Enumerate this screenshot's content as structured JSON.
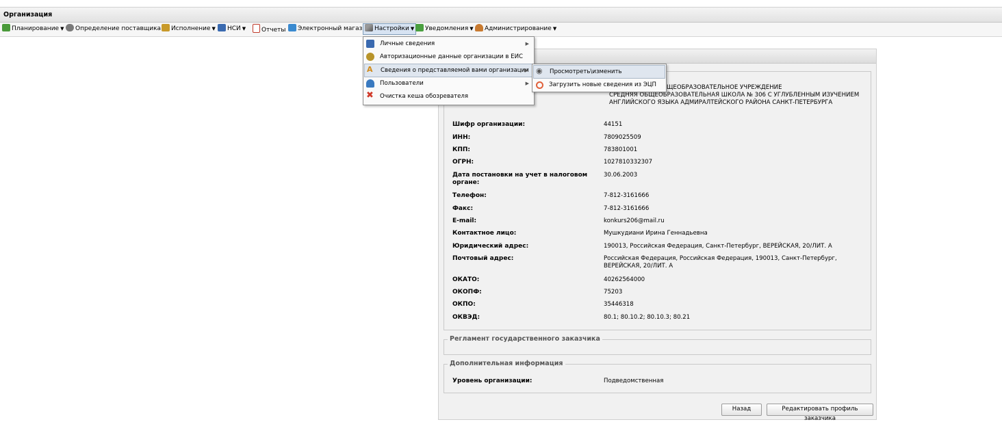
{
  "window": {
    "title": "Организация"
  },
  "toolbar": {
    "items": [
      {
        "label": "Планирование",
        "icon": "planning-icon",
        "color": "#4a9a3a",
        "has_arrow": true
      },
      {
        "label": "Определение поставщика",
        "icon": "supplier-gears-icon",
        "color": "#6b6b6b",
        "has_arrow": true
      },
      {
        "label": "Исполнение",
        "icon": "execution-icon",
        "color": "#c89a2a",
        "has_arrow": true
      },
      {
        "label": "НСИ",
        "icon": "nsi-book-icon",
        "color": "#3a6ab0",
        "has_arrow": true
      },
      {
        "label": "Отчеты",
        "icon": "report-icon",
        "color": "#c03a2a",
        "has_arrow": false
      },
      {
        "label": "Электронный магазин",
        "icon": "cart-icon",
        "color": "#3a8ad0",
        "has_arrow": false
      },
      {
        "label": "Настройки",
        "icon": "wrench-icon",
        "color": "#777777",
        "has_arrow": true
      },
      {
        "label": "Уведомления",
        "icon": "notification-icon",
        "color": "#4aa040",
        "has_arrow": true
      },
      {
        "label": "Администрирование",
        "icon": "admin-user-icon",
        "color": "#c87a30",
        "has_arrow": true
      }
    ]
  },
  "settings_menu": {
    "items": [
      {
        "label": "Личные сведения",
        "icon": "id-card-icon",
        "color": "#3a6ab0",
        "submenu": true
      },
      {
        "label": "Авторизационные данные организации в ЕИС",
        "icon": "emblem-icon",
        "color": "#b8942a",
        "submenu": false
      },
      {
        "label": "Сведения о представляемой вами организации",
        "icon": "letter-a-icon",
        "color": "#d08a1a",
        "submenu": true
      },
      {
        "label": "Пользователи",
        "icon": "users-icon",
        "color": "#3a7ac0",
        "submenu": true
      },
      {
        "label": "Очистка кеша обозревателя",
        "icon": "red-x-icon",
        "color": "#d03a2a",
        "submenu": false
      }
    ]
  },
  "org_submenu": {
    "items": [
      {
        "label": "Просмотреть\\изменить",
        "icon": "eye-icon"
      },
      {
        "label": "Загрузить новые сведения из ЭЦП",
        "icon": "signature-icon"
      }
    ]
  },
  "org": {
    "name_partial": "Е БЮДЖЕТНОЕ ОБЩЕОБРАЗОВАТЕЛЬНОЕ УЧРЕЖДЕНИЕ",
    "name_rest": "СРЕДНЯЯ ОБЩЕОБРАЗОВАТЕЛЬНАЯ ШКОЛА № 306 С УГЛУБЛЕННЫМ ИЗУЧЕНИЕМ АНГЛИЙСКОГО ЯЗЫКА АДМИРАЛТЕЙСКОГО РАЙОНА САНКТ-ПЕТЕРБУРГА",
    "fields": [
      {
        "label": "Шифр организации:",
        "value": "44151"
      },
      {
        "label": "ИНН:",
        "value": "7809025509"
      },
      {
        "label": "КПП:",
        "value": "783801001"
      },
      {
        "label": "ОГРН:",
        "value": "1027810332307"
      },
      {
        "label": "Дата постановки на учет в налоговом органе:",
        "value": "30.06.2003"
      },
      {
        "label": "Телефон:",
        "value": "7-812-3161666"
      },
      {
        "label": "Факс:",
        "value": "7-812-3161666"
      },
      {
        "label": "E-mail:",
        "value": "konkurs206@mail.ru"
      },
      {
        "label": "Контактное лицо:",
        "value": "Мушкудиани Ирина Геннадьевна"
      },
      {
        "label": "Юридический адрес:",
        "value": "190013, Российская Федерация, Санкт-Петербург, ВЕРЕЙСКАЯ, 20/ЛИТ. А"
      },
      {
        "label": "Почтовый адрес:",
        "value": "Российская Федерация, Российская Федерация, 190013, Санкт-Петербург, ВЕРЕЙСКАЯ, 20/ЛИТ. А"
      },
      {
        "label": "ОКАТО:",
        "value": "40262564000"
      },
      {
        "label": "ОКОПФ:",
        "value": "75203"
      },
      {
        "label": "ОКПО:",
        "value": "35446318"
      },
      {
        "label": "ОКВЭД:",
        "value": "80.1; 80.10.2; 80.10.3; 80.21"
      }
    ]
  },
  "regulation": {
    "legend": "Регламент государственного заказчика"
  },
  "additional": {
    "legend": "Дополнительная информация",
    "level_label": "Уровень организации:",
    "level_value": "Подведомственная"
  },
  "buttons": {
    "back": "Назад",
    "edit_profile": "Редактировать профиль заказчика"
  }
}
